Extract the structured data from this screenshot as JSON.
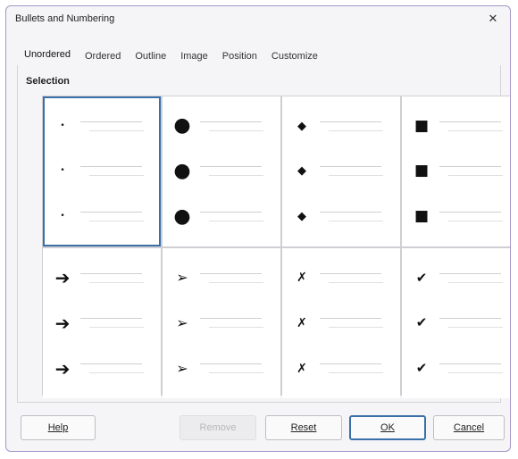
{
  "window": {
    "title": "Bullets and Numbering",
    "close_glyph": "✕"
  },
  "tabs": [
    {
      "label": "Unordered",
      "active": true
    },
    {
      "label": "Ordered"
    },
    {
      "label": "Outline"
    },
    {
      "label": "Image"
    },
    {
      "label": "Position"
    },
    {
      "label": "Customize"
    }
  ],
  "section_label": "Selection",
  "bullet_styles": [
    {
      "glyph": "•",
      "icon": "small-dot-icon",
      "selected": true
    },
    {
      "glyph": "●",
      "icon": "large-dot-icon"
    },
    {
      "glyph": "◆",
      "icon": "diamond-icon"
    },
    {
      "glyph": "■",
      "icon": "square-icon"
    },
    {
      "glyph": "➔",
      "icon": "arrow-icon"
    },
    {
      "glyph": "➢",
      "icon": "arrowhead-icon"
    },
    {
      "glyph": "✗",
      "icon": "x-mark-icon"
    },
    {
      "glyph": "✔",
      "icon": "checkmark-icon"
    }
  ],
  "buttons": {
    "help": "Help",
    "remove": "Remove",
    "reset": "Reset",
    "ok": "OK",
    "cancel": "Cancel"
  },
  "colors": {
    "border_accent": "#a596c8",
    "selection": "#3b6fa8"
  }
}
